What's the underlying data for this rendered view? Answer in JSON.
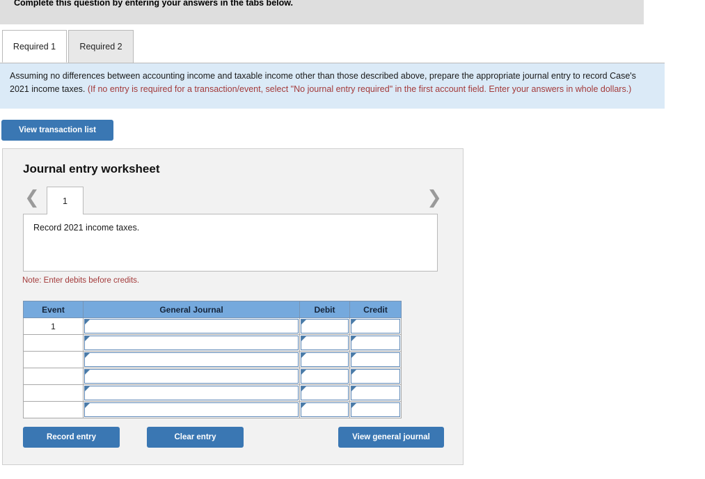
{
  "top_banner": {
    "text": "Complete this question by entering your answers in the tabs below."
  },
  "tabs": [
    {
      "label": "Required 1",
      "active": true
    },
    {
      "label": "Required 2",
      "active": false
    }
  ],
  "instruction": {
    "black_part_1": "Assuming no differences between accounting income and taxable income other than those described above, prepare the appropriate journal entry to record Case's 2021 income taxes. ",
    "red_part": "(If no entry is required for a transaction/event, select \"No journal entry required\" in the first account field. Enter your answers in whole dollars.)"
  },
  "buttons": {
    "view_transaction_list": "View transaction list",
    "record_entry": "Record entry",
    "clear_entry": "Clear entry",
    "view_general_journal": "View general journal"
  },
  "worksheet": {
    "title": "Journal entry worksheet",
    "prev_icon": "chevron-left-icon",
    "next_icon": "chevron-right-icon",
    "page_tab_label": "1",
    "description": "Record 2021 income taxes.",
    "note": "Note: Enter debits before credits."
  },
  "table": {
    "headers": [
      "Event",
      "General Journal",
      "Debit",
      "Credit"
    ],
    "rows": [
      {
        "event": "1",
        "general_journal": "",
        "debit": "",
        "credit": ""
      },
      {
        "event": "",
        "general_journal": "",
        "debit": "",
        "credit": ""
      },
      {
        "event": "",
        "general_journal": "",
        "debit": "",
        "credit": ""
      },
      {
        "event": "",
        "general_journal": "",
        "debit": "",
        "credit": ""
      },
      {
        "event": "",
        "general_journal": "",
        "debit": "",
        "credit": ""
      },
      {
        "event": "",
        "general_journal": "",
        "debit": "",
        "credit": ""
      }
    ]
  },
  "colors": {
    "button_blue": "#3a77b3",
    "table_header_blue": "#75a9dd",
    "instruction_blue": "#dbeaf7",
    "banner_gray": "#dedede",
    "panel_gray": "#f2f2f2",
    "red_text": "#a33a3a"
  }
}
